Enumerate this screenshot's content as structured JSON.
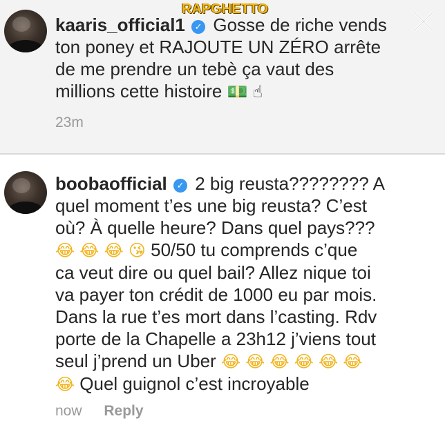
{
  "watermark": "RAPGHETTO",
  "first_comment": {
    "username": "kaaris_official1",
    "lines": [
      "Gosse de riche vends",
      "ton poney et RAJOUTE UN ZÉRO arrête",
      "de me prendre un tebè ça vaut des",
      "millions cette histoire"
    ],
    "emojis_line4": [
      "money-bag",
      "pointing-finger"
    ],
    "time": "23m"
  },
  "second_comment": {
    "username": "boobaofficial",
    "lines": [
      "2 big reusta???????? A",
      "quel moment t’es une big reusta? C’est",
      "où? À quelle heure? Dans quel pays???",
      "50/50 tu comprends c’que",
      "ca veut dire ou quel bail? Allez nique toi",
      "va payer ton crédit de 1000 eu par mois.",
      "Dans la rue t’es mort dans l’casting. Rdv",
      "porte de la Chapelle a 23h12 j’viens tout",
      "seul j’prend un Uber",
      "Quel guignol c’est incroyable"
    ],
    "time": "now",
    "reply_label": "Reply"
  },
  "colors": {
    "text": "#262626",
    "muted": "#999999",
    "verified": "#3897f0",
    "watermark": "#f1b813"
  },
  "icons": {
    "close": "close-icon",
    "verified": "verified-badge-icon",
    "laugh": "rolling-laughing-emoji",
    "kiss": "kissing-emoji"
  }
}
